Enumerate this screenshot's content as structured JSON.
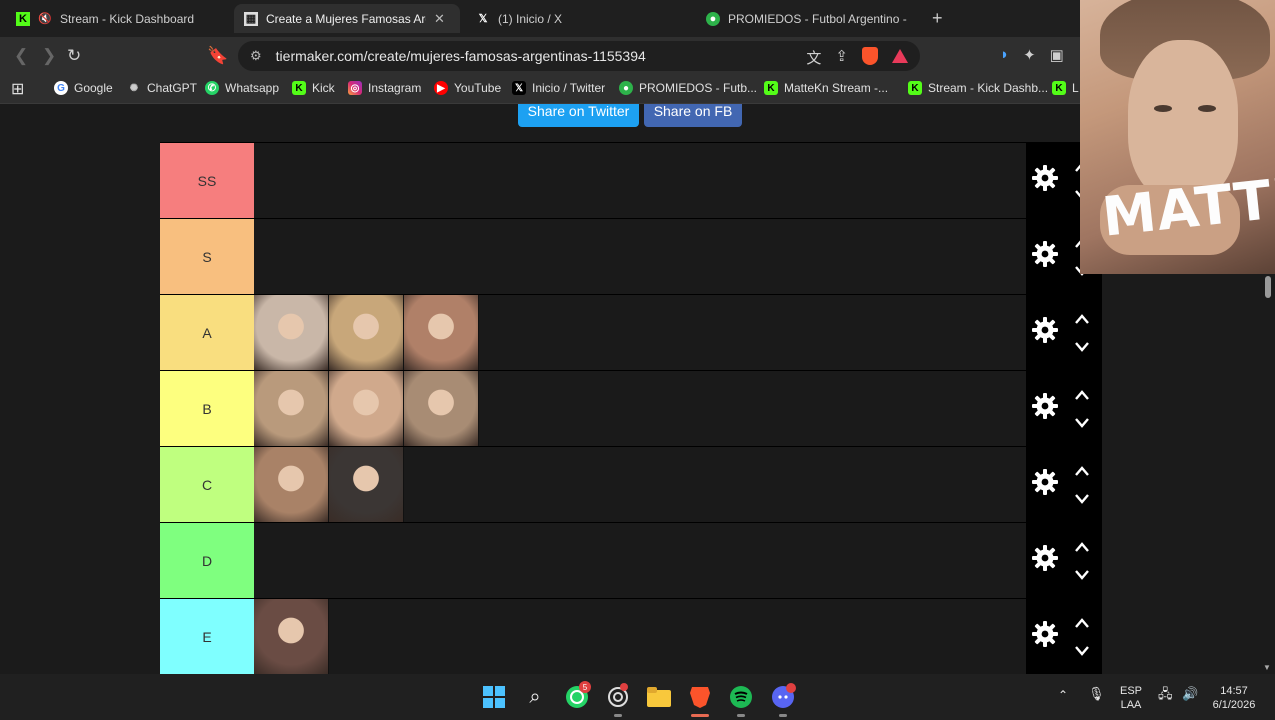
{
  "browser": {
    "tabs": [
      {
        "title": "Stream - Kick Dashboard",
        "active": false
      },
      {
        "title": "Create a Mujeres Famosas Argen",
        "active": true
      },
      {
        "title": "(1) Inicio / X",
        "active": false
      },
      {
        "title": "PROMIEDOS - Futbol Argentino - Fixt",
        "active": false
      }
    ],
    "url": "tiermaker.com/create/mujeres-famosas-argentinas-1155394",
    "bookmarks": [
      {
        "label": "Google",
        "icon": "google-icon"
      },
      {
        "label": "ChatGPT",
        "icon": "chatgpt-icon"
      },
      {
        "label": "Whatsapp",
        "icon": "whatsapp-icon"
      },
      {
        "label": "Kick",
        "icon": "kick-icon"
      },
      {
        "label": "Instagram",
        "icon": "instagram-icon"
      },
      {
        "label": "YouTube",
        "icon": "youtube-icon"
      },
      {
        "label": "Inicio / Twitter",
        "icon": "x-icon"
      },
      {
        "label": "PROMIEDOS - Futb...",
        "icon": "promiedos-icon"
      },
      {
        "label": "MatteKn Stream -...",
        "icon": "kick-icon"
      },
      {
        "label": "Stream - Kick Dashb...",
        "icon": "kick-icon"
      },
      {
        "label": "L",
        "icon": "kick-icon"
      }
    ]
  },
  "page": {
    "share_twitter": "Share on Twitter",
    "share_fb": "Share on FB",
    "tiers": [
      {
        "label": "SS",
        "color": "#f67e7e",
        "images": []
      },
      {
        "label": "S",
        "color": "#f8bf7f",
        "images": []
      },
      {
        "label": "A",
        "color": "#f9de7f",
        "images": [
          "#c9b7a8",
          "#c8a77a",
          "#b08068"
        ]
      },
      {
        "label": "B",
        "color": "#fdff7f",
        "images": [
          "#b99a7c",
          "#d0a98c",
          "#a88c74"
        ]
      },
      {
        "label": "C",
        "color": "#bfff7f",
        "images": [
          "#a98267",
          "#3b3634"
        ]
      },
      {
        "label": "D",
        "color": "#7fff7f",
        "images": []
      },
      {
        "label": "E",
        "color": "#7fffff",
        "images": [
          "#6a4c44"
        ]
      }
    ]
  },
  "webcam": {
    "overlay_text": "MATTE"
  },
  "taskbar": {
    "whatsapp_badge": "5",
    "language": "ESP",
    "layout": "LAA",
    "time": "14:57",
    "date": "6/1/2026"
  }
}
